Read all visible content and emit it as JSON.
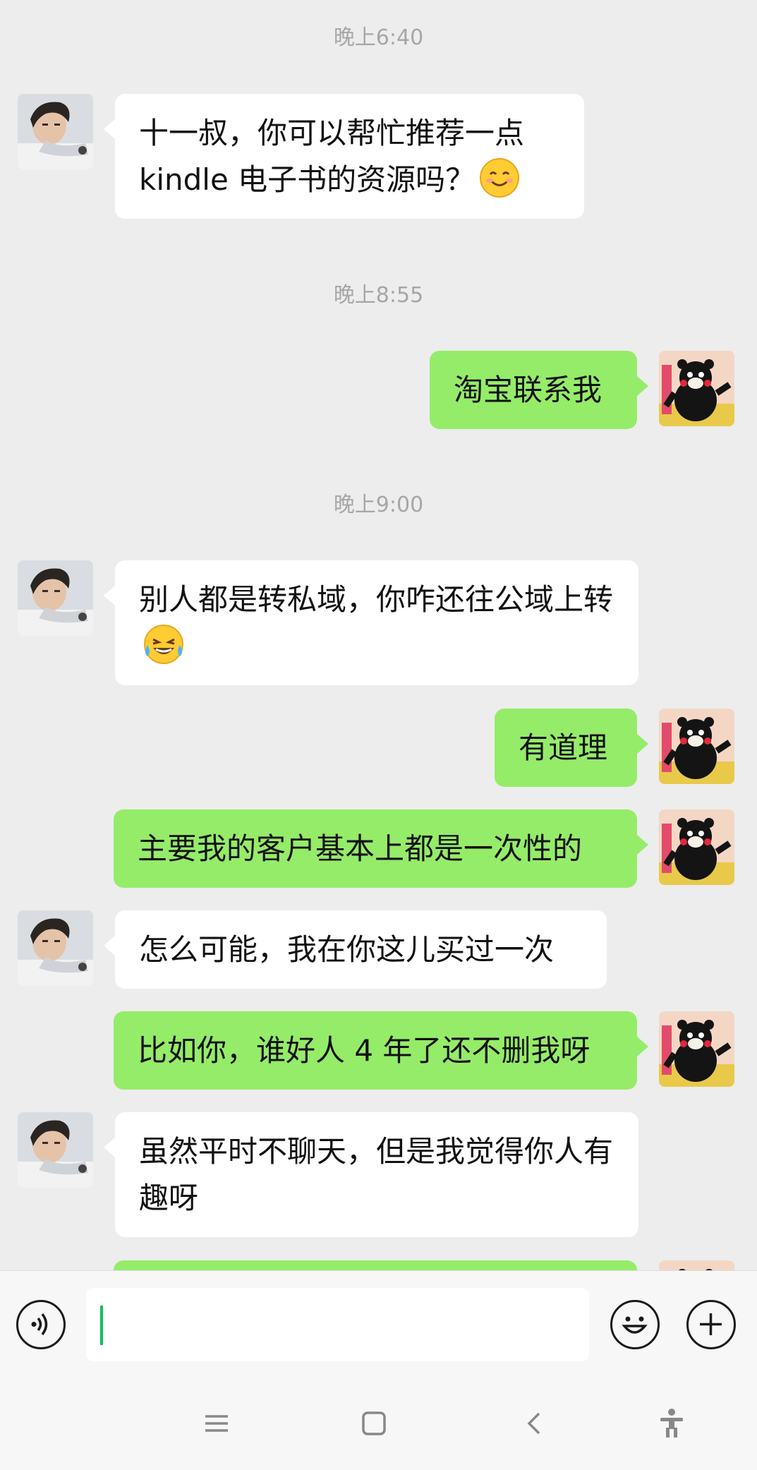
{
  "messages": [
    {
      "type": "time",
      "text": "晚上6:40"
    },
    {
      "type": "peer",
      "text": "十一叔，你可以帮忙推荐一点kindle 电子书的资源吗？",
      "emoji": "smile-emoji"
    },
    {
      "type": "time",
      "text": "晚上8:55"
    },
    {
      "type": "self",
      "text": "淘宝联系我"
    },
    {
      "type": "time",
      "text": "晚上9:00"
    },
    {
      "type": "peer",
      "text": "别人都是转私域，你咋还往公域上转",
      "emoji": "laughing-tears-emoji"
    },
    {
      "type": "self",
      "text": "有道理"
    },
    {
      "type": "self",
      "text": "主要我的客户基本上都是一次性的"
    },
    {
      "type": "peer",
      "text": "怎么可能，我在你这儿买过一次"
    },
    {
      "type": "self",
      "text": "比如你，谁好人 4 年了还不删我呀"
    },
    {
      "type": "peer",
      "text": "虽然平时不聊天，但是我觉得你人有趣呀"
    }
  ],
  "input_bar": {
    "voice_icon": "voice-icon",
    "input_value": "",
    "emoji_icon": "emoji-icon",
    "plus_icon": "plus-icon"
  },
  "nav_bar": {
    "icons": [
      "menu-icon",
      "home-icon",
      "back-icon",
      "accessibility-icon"
    ]
  },
  "colors": {
    "self_bubble": "#95ec69",
    "peer_bubble": "#ffffff",
    "background": "#ededed",
    "caret": "#07c160"
  }
}
